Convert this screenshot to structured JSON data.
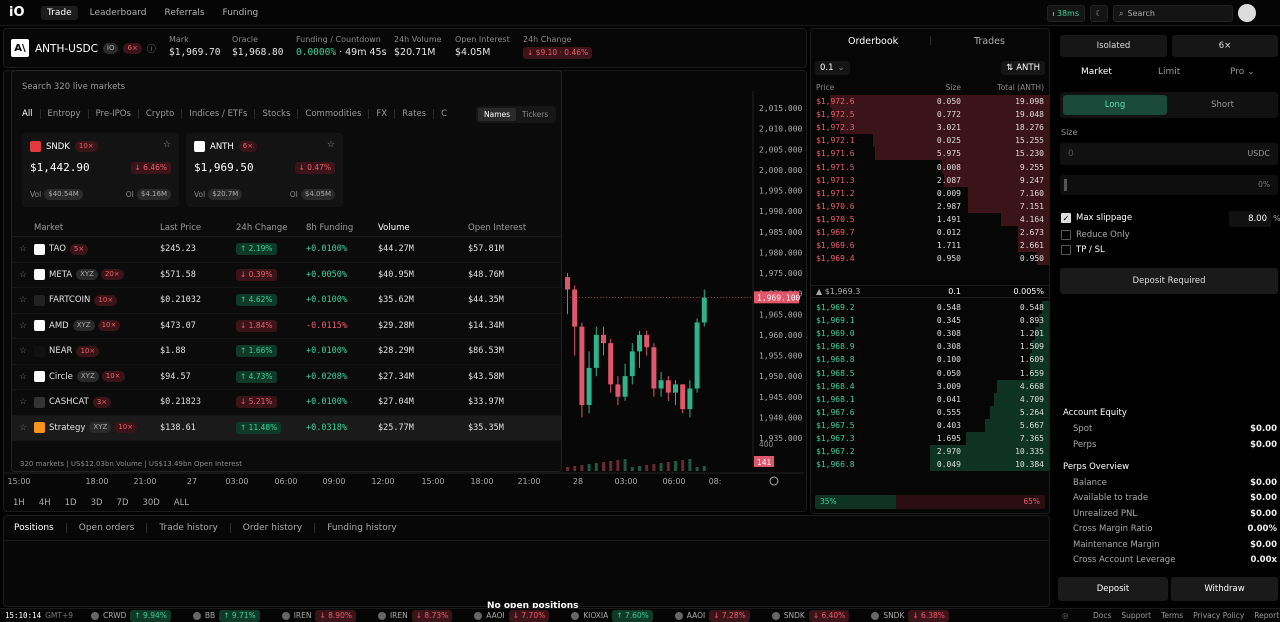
{
  "top": {
    "logo": "iO",
    "nav": [
      "Trade",
      "Leaderboard",
      "Referrals",
      "Funding"
    ],
    "latency": "38ms",
    "search_placeholder": "Search"
  },
  "market": {
    "symbol": "ANTH-USDC",
    "venue": "IO",
    "lev": "6×",
    "stats": [
      {
        "label": "Mark",
        "value": "$1,969.70"
      },
      {
        "label": "Oracle",
        "value": "$1,968.80"
      },
      {
        "label": "Funding / Countdown",
        "value": "0.0000%",
        "value2": "· 49m 45s"
      },
      {
        "label": "24h Volume",
        "value": "$20.71M"
      },
      {
        "label": "Open Interest",
        "value": "$4.05M"
      },
      {
        "label": "24h Change",
        "value": "↓ $9.10 · 0.46%"
      }
    ]
  },
  "dropdown": {
    "search": "Search 320 live markets",
    "cats": [
      "All",
      "Entropy",
      "Pre-IPOs",
      "Crypto",
      "Indices / ETFs",
      "Stocks",
      "Commodities",
      "FX",
      "Rates",
      "C"
    ],
    "toggle": [
      "Names",
      "Tickers"
    ],
    "cards": [
      {
        "name": "SNDK",
        "lev": "10×",
        "price": "$1,442.90",
        "chg": "↓ 6.46%",
        "vol_label": "Vol",
        "vol": "$40.54M",
        "oi_label": "OI",
        "oi": "$4.16M"
      },
      {
        "name": "ANTH",
        "lev": "6×",
        "price": "$1,969.50",
        "chg": "↓ 0.47%",
        "vol_label": "Vol",
        "vol": "$20.7M",
        "oi_label": "OI",
        "oi": "$4.05M"
      }
    ],
    "cols": [
      "Market",
      "Last Price",
      "24h Change",
      "8h Funding",
      "Volume",
      "Open Interest"
    ],
    "rows": [
      {
        "name": "TAO",
        "tags": [
          "5×"
        ],
        "price": "$245.23",
        "chg": "↑ 2.19%",
        "up": true,
        "fund": "+0.0100%",
        "vol": "$44.27M",
        "oi": "$57.81M",
        "color": "#ffffff"
      },
      {
        "name": "META",
        "tags": [
          "XYZ",
          "20×"
        ],
        "price": "$571.58",
        "chg": "↓ 0.39%",
        "up": false,
        "fund": "+0.0050%",
        "vol": "$40.95M",
        "oi": "$48.76M",
        "color": "#ffffff"
      },
      {
        "name": "FARTCOIN",
        "tags": [
          "10×"
        ],
        "price": "$0.21032",
        "chg": "↑ 4.62%",
        "up": true,
        "fund": "+0.0100%",
        "vol": "$35.62M",
        "oi": "$44.35M",
        "color": "#222222"
      },
      {
        "name": "AMD",
        "tags": [
          "XYZ",
          "10×"
        ],
        "price": "$473.07",
        "chg": "↓ 1.84%",
        "up": false,
        "fund": "-0.0115%",
        "vol": "$29.28M",
        "oi": "$14.34M",
        "color": "#ffffff"
      },
      {
        "name": "NEAR",
        "tags": [
          "10×"
        ],
        "price": "$1.88",
        "chg": "↑ 1.66%",
        "up": true,
        "fund": "+0.0100%",
        "vol": "$28.29M",
        "oi": "$86.53M",
        "color": "#111111"
      },
      {
        "name": "Circle",
        "tags": [
          "XYZ",
          "10×"
        ],
        "price": "$94.57",
        "chg": "↑ 4.73%",
        "up": true,
        "fund": "+0.0208%",
        "vol": "$27.34M",
        "oi": "$43.58M",
        "color": "#ffffff"
      },
      {
        "name": "CASHCAT",
        "tags": [
          "3×"
        ],
        "price": "$0.21823",
        "chg": "↓ 5.21%",
        "up": false,
        "fund": "+0.0100%",
        "vol": "$27.04M",
        "oi": "$33.97M",
        "color": "#333333"
      },
      {
        "name": "Strategy",
        "tags": [
          "XYZ",
          "10×"
        ],
        "price": "$138.61",
        "chg": "↑ 11.48%",
        "up": true,
        "fund": "+0.0318%",
        "vol": "$25.77M",
        "oi": "$35.35M",
        "color": "#f7931a"
      }
    ],
    "footer": "320 markets  |  US$12.03bn  Volume  |  US$13.49bn  Open Interest"
  },
  "chart_data": {
    "type": "candlestick",
    "y_ticks": [
      "2,015.000",
      "2,010.000",
      "2,005.000",
      "2,000.000",
      "1,995.000",
      "1,990.000",
      "1,985.000",
      "1,980.000",
      "1,975.000",
      "1,970.000",
      "1,965.000",
      "1,960.000",
      "1,955.000",
      "1,950.000",
      "1,945.000",
      "1,940.000",
      "1,935.000"
    ],
    "ylim": [
      1935,
      2015
    ],
    "x_ticks": [
      "15:00",
      "18:00",
      "21:00",
      "27",
      "03:00",
      "06:00",
      "09:00",
      "12:00",
      "15:00",
      "18:00",
      "21:00",
      "28",
      "03:00",
      "06:00",
      "08:"
    ],
    "last_price": "1,969.100",
    "volume_label": "400",
    "volume_last": "141",
    "candles": [
      [
        1974,
        1971,
        1975,
        1965
      ],
      [
        1971,
        1962,
        1972,
        1955
      ],
      [
        1962,
        1943,
        1963,
        1940
      ],
      [
        1943,
        1952,
        1956,
        1941
      ],
      [
        1952,
        1960,
        1962,
        1950
      ],
      [
        1960,
        1958,
        1962,
        1955
      ],
      [
        1958,
        1948,
        1959,
        1946
      ],
      [
        1948,
        1945,
        1950,
        1943
      ],
      [
        1945,
        1950,
        1953,
        1944
      ],
      [
        1950,
        1956,
        1958,
        1948
      ],
      [
        1956,
        1960,
        1961,
        1952
      ],
      [
        1960,
        1957,
        1961,
        1955
      ],
      [
        1957,
        1947,
        1958,
        1945
      ],
      [
        1947,
        1949,
        1951,
        1945
      ],
      [
        1949,
        1946,
        1950,
        1944
      ],
      [
        1946,
        1948,
        1949,
        1943
      ],
      [
        1948,
        1942,
        1948,
        1941
      ],
      [
        1942,
        1947,
        1949,
        1940
      ],
      [
        1947,
        1963,
        1964,
        1946
      ],
      [
        1963,
        1969,
        1971,
        1962
      ]
    ],
    "timeframes": [
      "1H",
      "4H",
      "1D",
      "3D",
      "7D",
      "30D",
      "ALL"
    ]
  },
  "orderbook": {
    "tabs": [
      "Orderbook",
      "Trades"
    ],
    "tick": "0.1",
    "unit": "ANTH",
    "cols": [
      "Price",
      "Size",
      "Total (ANTH)"
    ],
    "asks": [
      [
        "$1,972.6",
        "0.050",
        "19.098",
        0.92
      ],
      [
        "$1,972.5",
        "0.772",
        "19.048",
        0.91
      ],
      [
        "$1,972.3",
        "3.021",
        "18.276",
        0.88
      ],
      [
        "$1,972.1",
        "0.025",
        "15.255",
        0.74
      ],
      [
        "$1,971.6",
        "5.975",
        "15.230",
        0.73
      ],
      [
        "$1,971.5",
        "0.008",
        "9.255",
        0.45
      ],
      [
        "$1,971.3",
        "2.087",
        "9.247",
        0.44
      ],
      [
        "$1,971.2",
        "0.009",
        "7.160",
        0.34
      ],
      [
        "$1,970.6",
        "2.987",
        "7.151",
        0.34
      ],
      [
        "$1,970.5",
        "1.491",
        "4.164",
        0.2
      ],
      [
        "$1,969.7",
        "0.012",
        "2.673",
        0.13
      ],
      [
        "$1,969.6",
        "1.711",
        "2.661",
        0.13
      ],
      [
        "$1,969.4",
        "0.950",
        "0.950",
        0.05
      ]
    ],
    "mid": {
      "price": "▲ $1,969.3",
      "spread": "0.1",
      "pct": "0.005%"
    },
    "bids": [
      [
        "$1,969.2",
        "0.548",
        "0.548",
        0.03
      ],
      [
        "$1,969.1",
        "0.345",
        "0.893",
        0.04
      ],
      [
        "$1,969.0",
        "0.308",
        "1.201",
        0.06
      ],
      [
        "$1,968.9",
        "0.308",
        "1.509",
        0.07
      ],
      [
        "$1,968.8",
        "0.100",
        "1.609",
        0.08
      ],
      [
        "$1,968.5",
        "0.050",
        "1.659",
        0.08
      ],
      [
        "$1,968.4",
        "3.009",
        "4.668",
        0.22
      ],
      [
        "$1,968.1",
        "0.041",
        "4.709",
        0.23
      ],
      [
        "$1,967.6",
        "0.555",
        "5.264",
        0.25
      ],
      [
        "$1,967.5",
        "0.403",
        "5.667",
        0.27
      ],
      [
        "$1,967.3",
        "1.695",
        "7.365",
        0.35
      ],
      [
        "$1,967.2",
        "2.970",
        "10.335",
        0.5
      ],
      [
        "$1,966.8",
        "0.049",
        "10.384",
        0.5
      ]
    ],
    "ratio_bid": "35%",
    "ratio_ask": "65%",
    "ratio_bid_frac": 0.35
  },
  "trade": {
    "margin": "Isolated",
    "lev": "6×",
    "types": [
      "Market",
      "Limit",
      "Pro ⌄"
    ],
    "long": "Long",
    "short": "Short",
    "size_label": "Size",
    "size_ph": "0",
    "unit": "USDC",
    "pct": "0%",
    "max_slip": "Max slippage",
    "slip_val": "8.00",
    "slip_unit": "%",
    "reduce": "Reduce Only",
    "tpsl": "TP / SL",
    "deposit_req": "Deposit Required",
    "equity_title": "Account Equity",
    "equity": [
      [
        "Spot",
        "$0.00"
      ],
      [
        "Perps",
        "$0.00"
      ]
    ],
    "perps_title": "Perps Overview",
    "perps": [
      [
        "Balance",
        "$0.00"
      ],
      [
        "Available to trade",
        "$0.00"
      ],
      [
        "Unrealized PNL",
        "$0.00"
      ],
      [
        "Cross Margin Ratio",
        "0.00%"
      ],
      [
        "Maintenance Margin",
        "$0.00"
      ],
      [
        "Cross Account Leverage",
        "0.00x"
      ]
    ],
    "deposit": "Deposit",
    "withdraw": "Withdraw"
  },
  "bottom": {
    "tabs": [
      "Positions",
      "Open orders",
      "Trade history",
      "Order history",
      "Funding history"
    ],
    "empty": "No open positions"
  },
  "ticker": {
    "time": "15:10:14",
    "tz": "GMT+9",
    "items": [
      [
        "CRWD",
        "↑ 9.94%",
        true
      ],
      [
        "BB",
        "↑ 9.71%",
        true
      ],
      [
        "IREN",
        "↓ 8.90%",
        false
      ],
      [
        "IREN",
        "↓ 8.73%",
        false
      ],
      [
        "AAOI",
        "↓ 7.70%",
        false
      ],
      [
        "KIOXIA",
        "↑ 7.60%",
        true
      ],
      [
        "AAOI",
        "↓ 7.28%",
        false
      ],
      [
        "SNDK",
        "↓ 6.40%",
        false
      ],
      [
        "SNDK",
        "↓ 6.38%",
        false
      ]
    ],
    "links": [
      "Docs",
      "Support",
      "Terms",
      "Privacy Policy",
      "Report a Bug"
    ]
  }
}
